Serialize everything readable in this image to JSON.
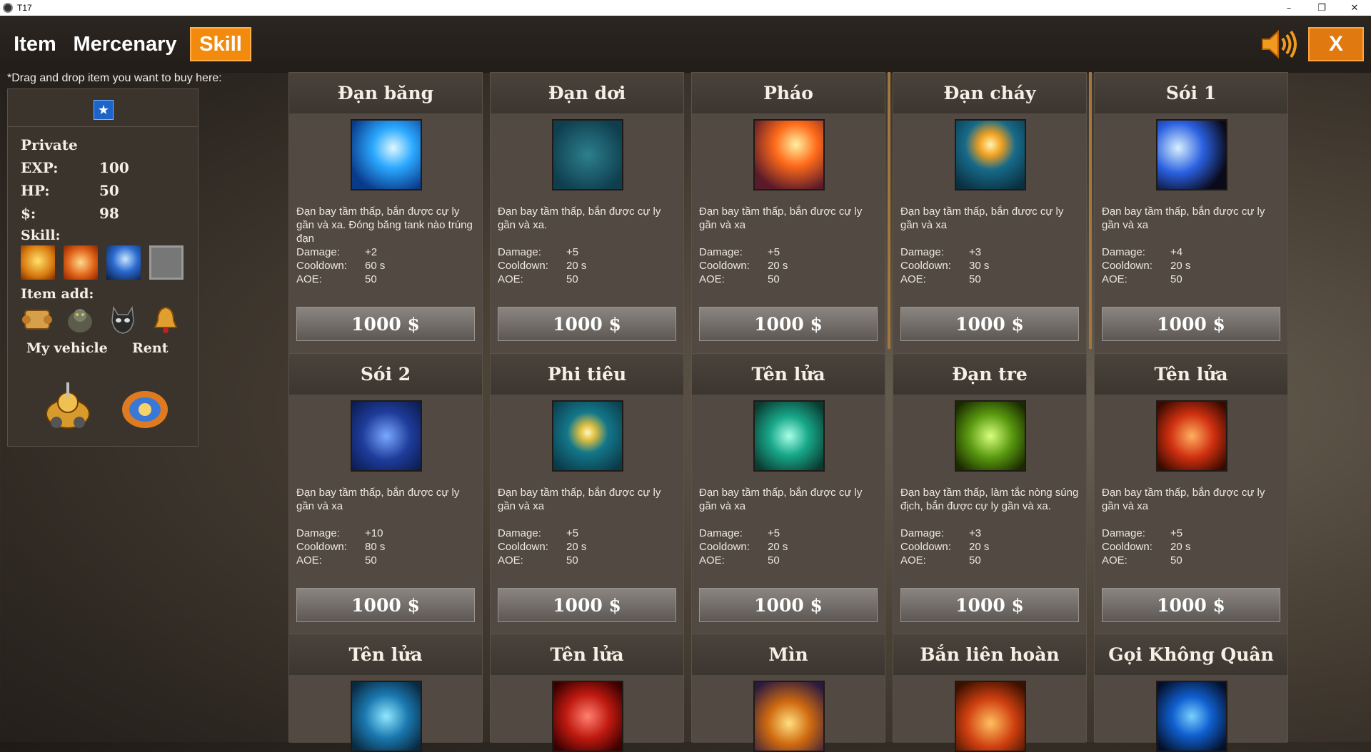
{
  "window": {
    "title": "T17",
    "minimize": "–",
    "restore": "❐",
    "close": "✕"
  },
  "tabs": {
    "item": "Item",
    "mercenary": "Mercenary",
    "skill": "Skill"
  },
  "close_label": "X",
  "drag_hint": "*Drag and drop item you want to buy here:",
  "player": {
    "rank": "Private",
    "exp_label": "EXP:",
    "exp": "100",
    "hp_label": "HP:",
    "hp": "50",
    "money_label": "$:",
    "money": "98",
    "skill_label": "Skill:",
    "item_add_label": "Item add:",
    "my_vehicle_label": "My vehicle",
    "rent_label": "Rent"
  },
  "stat_labels": {
    "damage": "Damage:",
    "cooldown": "Cooldown:",
    "aoe": "AOE:"
  },
  "skills": [
    {
      "name": "Đạn băng",
      "desc": "Đạn bay tầm thấp, bắn được cự ly gần và xa. Đóng băng tank nào trúng đạn",
      "damage": "+2",
      "cooldown": "60 s",
      "aoe": "50",
      "price": "1000 $",
      "icon": "ice-bullet-icon"
    },
    {
      "name": "Đạn dơi",
      "desc": "Đạn bay tầm thấp, bắn được cự ly gần và xa.",
      "damage": "+5",
      "cooldown": "20 s",
      "aoe": "50",
      "price": "1000 $",
      "icon": "bat-bullet-icon"
    },
    {
      "name": "Pháo",
      "desc": "Đạn bay tầm thấp, bắn được cự ly gần và xa",
      "damage": "+5",
      "cooldown": "20 s",
      "aoe": "50",
      "price": "1000 $",
      "icon": "cannon-icon"
    },
    {
      "name": "Đạn cháy",
      "desc": "Đạn bay tầm thấp, bắn được cự ly gần và xa",
      "damage": "+3",
      "cooldown": "30 s",
      "aoe": "50",
      "price": "1000 $",
      "icon": "fire-bullet-icon"
    },
    {
      "name": "Sói 1",
      "desc": "Đạn bay tầm thấp, bắn được cự ly gần và xa",
      "damage": "+4",
      "cooldown": "20 s",
      "aoe": "50",
      "price": "1000 $",
      "icon": "wolf-icon"
    },
    {
      "name": "Sói 2",
      "desc": "Đạn bay tầm thấp, bắn được cự ly gần và xa",
      "damage": "+10",
      "cooldown": "80 s",
      "aoe": "50",
      "price": "1000 $",
      "icon": "wolf-2-icon"
    },
    {
      "name": "Phi tiêu",
      "desc": "Đạn bay tầm thấp, bắn được cự ly gần và xa",
      "damage": "+5",
      "cooldown": "20 s",
      "aoe": "50",
      "price": "1000 $",
      "icon": "dart-icon"
    },
    {
      "name": "Tên lửa",
      "desc": "Đạn bay tầm thấp, bắn được cự ly gần và xa",
      "damage": "+5",
      "cooldown": "20 s",
      "aoe": "50",
      "price": "1000 $",
      "icon": "missile-icon"
    },
    {
      "name": "Đạn tre",
      "desc": "Đạn bay tầm thấp, làm tắc nòng súng địch, bắn được cự ly gần và xa.",
      "damage": "+3",
      "cooldown": "20 s",
      "aoe": "50",
      "price": "1000 $",
      "icon": "bamboo-bullet-icon"
    },
    {
      "name": "Tên lửa",
      "desc": "Đạn bay tầm thấp, bắn được cự ly gần và xa",
      "damage": "+5",
      "cooldown": "20 s",
      "aoe": "50",
      "price": "1000 $",
      "icon": "rocket-icon"
    },
    {
      "name": "Tên lửa",
      "icon": "missile-blue-icon"
    },
    {
      "name": "Tên lửa",
      "icon": "missile-red-icon"
    },
    {
      "name": "Mìn",
      "icon": "mine-icon"
    },
    {
      "name": "Bắn liên hoàn",
      "icon": "rapid-fire-icon"
    },
    {
      "name": "Gọi Không Quân",
      "icon": "air-strike-icon"
    }
  ],
  "colors": {
    "accent": "#f28a0d",
    "card_body": "#524a42",
    "panel": "#3a342d"
  }
}
